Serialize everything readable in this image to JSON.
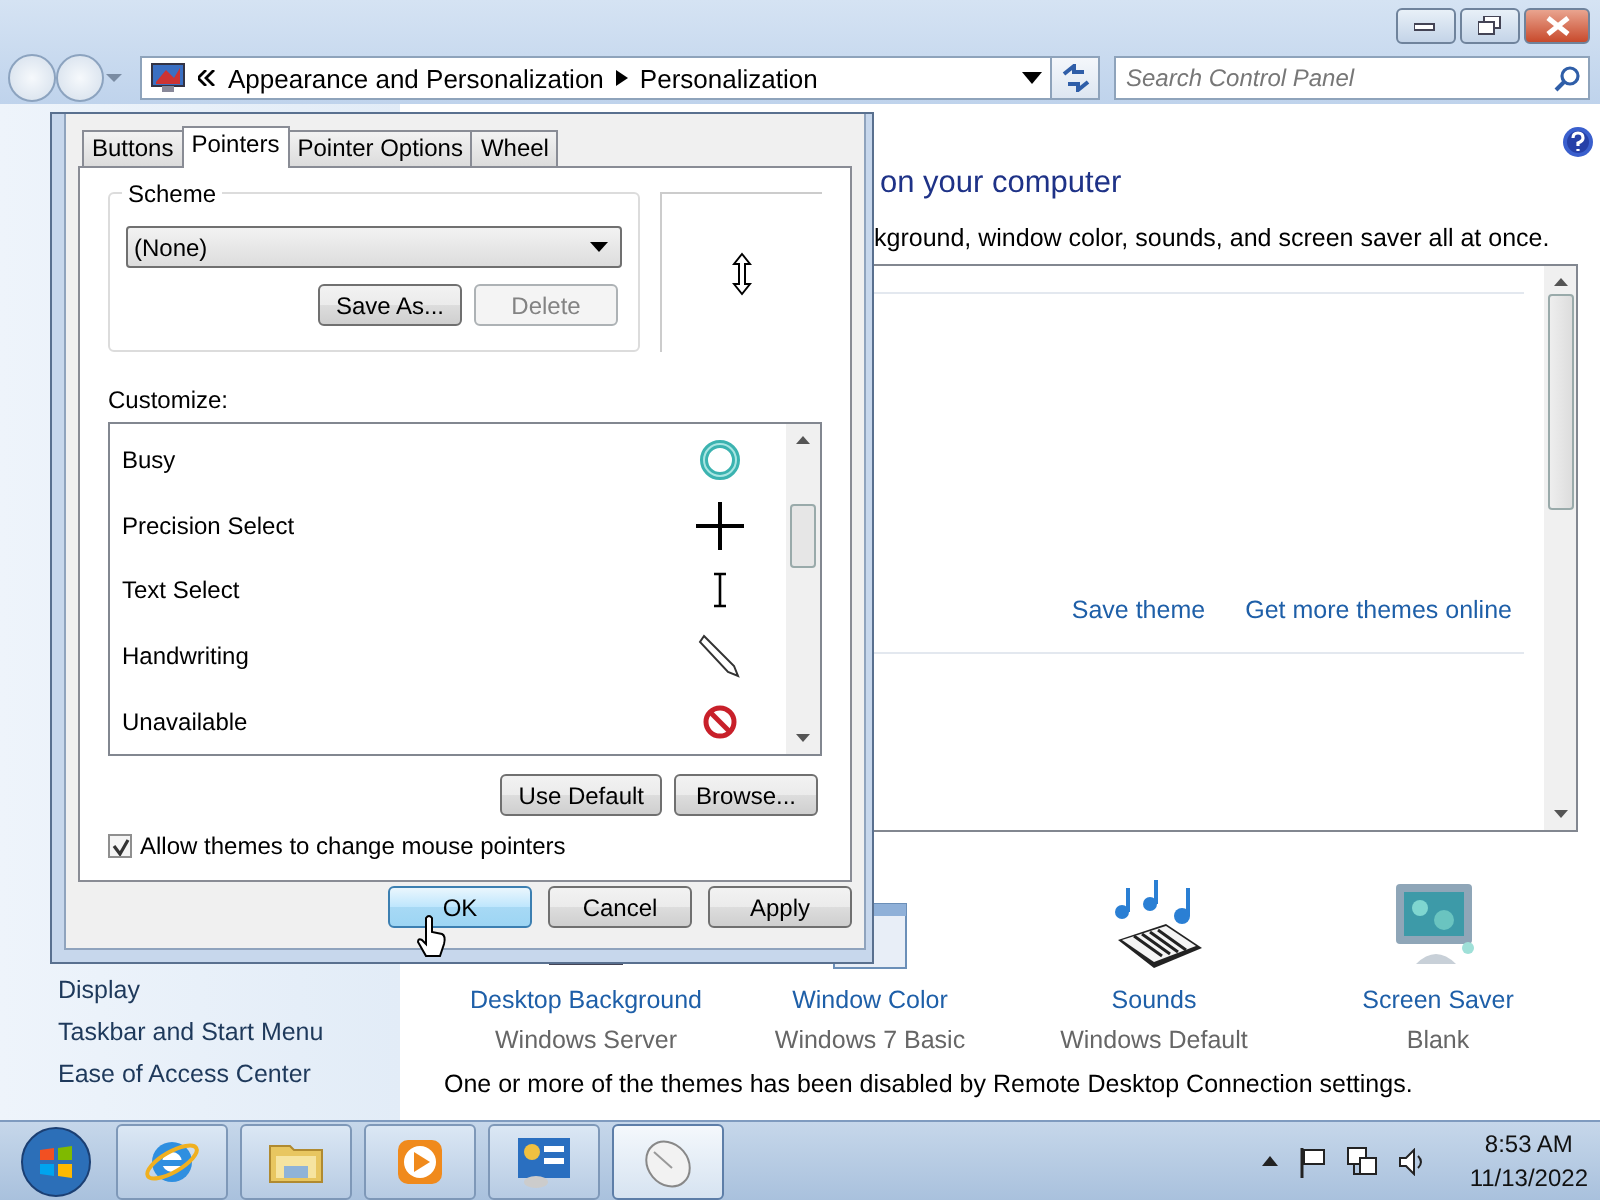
{
  "address_bar": {
    "crumbs": [
      "Appearance and Personalization",
      "Personalization"
    ]
  },
  "search": {
    "placeholder": "Search Control Panel"
  },
  "sidebar": {
    "items": [
      "Display",
      "Taskbar and Start Menu",
      "Ease of Access Center"
    ]
  },
  "content": {
    "heading": "on your computer",
    "description": "kground, window color, sounds, and screen saver all at once.",
    "theme_links": [
      "Save theme",
      "Get more themes online"
    ],
    "settings": [
      {
        "kind": "background",
        "label": "Desktop Background",
        "value": "Windows Server"
      },
      {
        "kind": "color",
        "label": "Window Color",
        "value": "Windows 7 Basic"
      },
      {
        "kind": "sounds",
        "label": "Sounds",
        "value": "Windows Default"
      },
      {
        "kind": "saver",
        "label": "Screen Saver",
        "value": "Blank"
      }
    ],
    "notice": "One or more of the themes has been disabled by Remote Desktop Connection settings."
  },
  "dialog": {
    "tabs": [
      {
        "label": "Buttons",
        "selected": false
      },
      {
        "label": "Pointers",
        "selected": true
      },
      {
        "label": "Pointer Options",
        "selected": false
      },
      {
        "label": "Wheel",
        "selected": false
      }
    ],
    "scheme_label": "Scheme",
    "scheme_value": "(None)",
    "scheme_buttons": [
      {
        "label": "Save As...",
        "disabled": false
      },
      {
        "label": "Delete",
        "disabled": true
      }
    ],
    "customize_label": "Customize:",
    "pointers": [
      {
        "name": "Busy",
        "kind": "busy"
      },
      {
        "name": "Precision Select",
        "kind": "cross"
      },
      {
        "name": "Text Select",
        "kind": "beam"
      },
      {
        "name": "Handwriting",
        "kind": "pen"
      },
      {
        "name": "Unavailable",
        "kind": "no"
      }
    ],
    "list_buttons": [
      "Use Default",
      "Browse..."
    ],
    "allow_themes": {
      "label": "Allow themes to change mouse pointers",
      "checked": true
    },
    "buttons": [
      {
        "label": "OK",
        "default": true
      },
      {
        "label": "Cancel",
        "default": false
      },
      {
        "label": "Apply",
        "default": false
      }
    ]
  },
  "taskbar": {
    "apps": [
      {
        "kind": "ie",
        "active": false
      },
      {
        "kind": "folder",
        "active": false
      },
      {
        "kind": "media",
        "active": false
      },
      {
        "kind": "panel",
        "active": false
      },
      {
        "kind": "mouse",
        "active": true
      }
    ],
    "clock": {
      "time": "8:53 AM",
      "date": "11/13/2022"
    }
  }
}
